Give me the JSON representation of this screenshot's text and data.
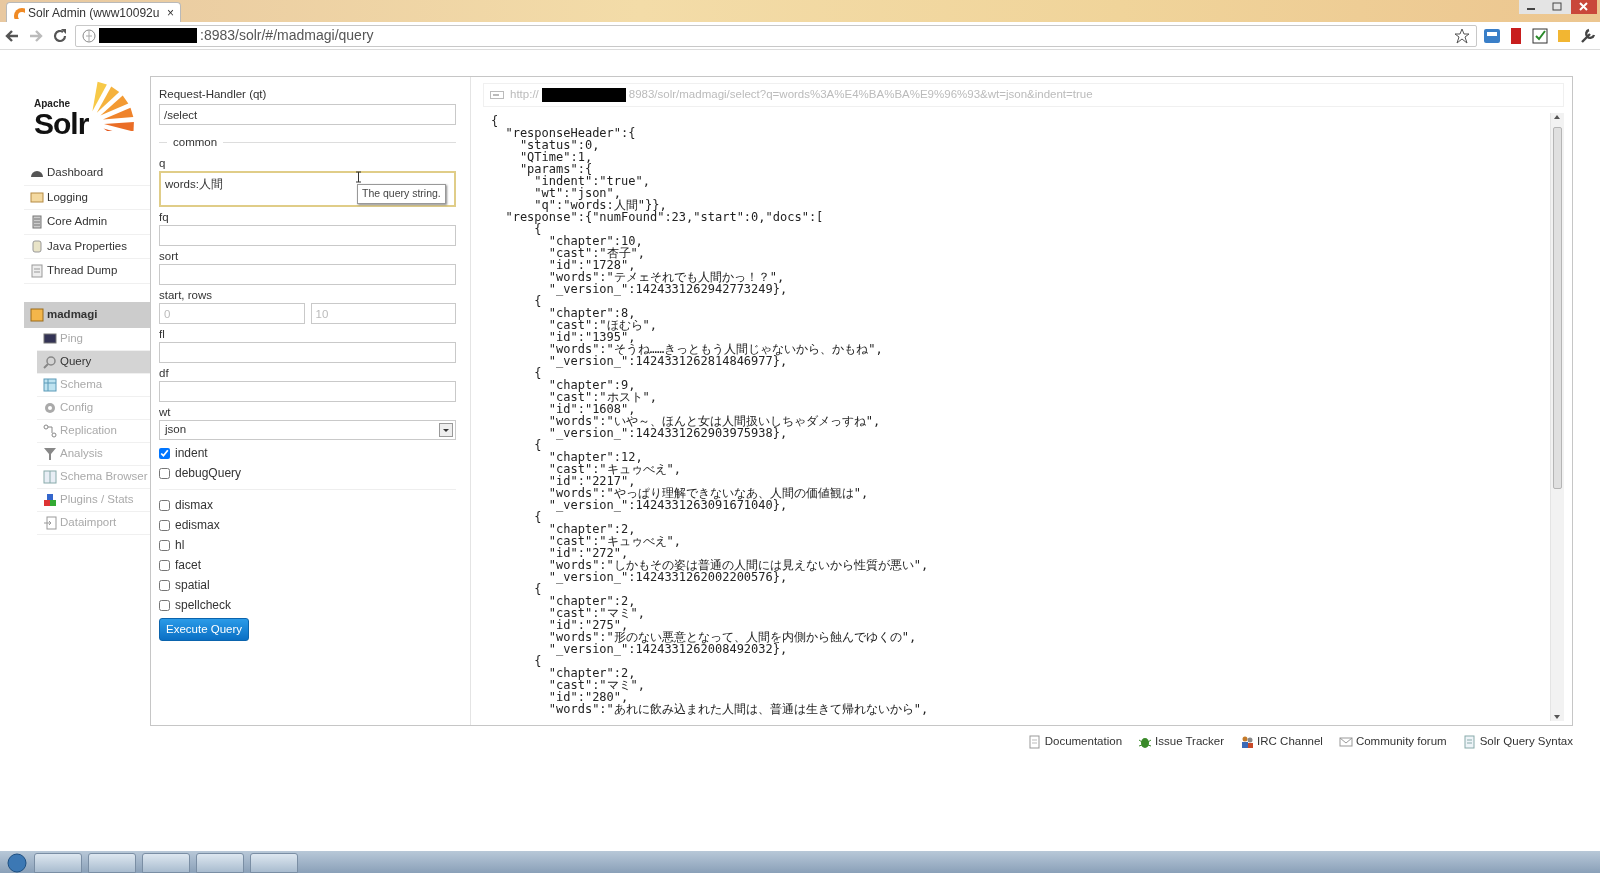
{
  "browser": {
    "tabs": [
      {
        "title": "Solr Admin (www10092u",
        "close": "×",
        "selected": true
      }
    ],
    "address": {
      "suffix": ":8983/solr/#/madmagi/query"
    }
  },
  "logo": {
    "small": "Apache",
    "big": "Solr"
  },
  "main_menu": [
    {
      "label": "Dashboard"
    },
    {
      "label": "Logging"
    },
    {
      "label": "Core Admin"
    },
    {
      "label": "Java Properties"
    },
    {
      "label": "Thread Dump"
    }
  ],
  "core": {
    "label": "madmagi",
    "selected": true
  },
  "core_menu": [
    {
      "label": "Ping",
      "selected": false
    },
    {
      "label": "Query",
      "selected": true
    },
    {
      "label": "Schema",
      "selected": false
    },
    {
      "label": "Config",
      "selected": false
    },
    {
      "label": "Replication",
      "selected": false
    },
    {
      "label": "Analysis",
      "selected": false
    },
    {
      "label": "Schema Browser",
      "selected": false
    },
    {
      "label": "Plugins / Stats",
      "selected": false
    },
    {
      "label": "Dataimport",
      "selected": false
    }
  ],
  "form": {
    "handler": {
      "label": "Request-Handler (qt)",
      "value": "/select"
    },
    "legend": "common",
    "fields": [
      {
        "kind": "textarea",
        "label": "q",
        "value": "words:人間",
        "focused": true,
        "tooltip": "The query string."
      },
      {
        "kind": "text",
        "label": "fq"
      },
      {
        "kind": "text",
        "label": "sort"
      },
      {
        "kind": "pair",
        "label": "start, rows",
        "inputs": [
          {
            "placeholder": "0"
          },
          {
            "placeholder": "10"
          }
        ]
      },
      {
        "kind": "text",
        "label": "fl"
      },
      {
        "kind": "text",
        "label": "df"
      },
      {
        "kind": "select",
        "label": "wt",
        "value": "json"
      }
    ],
    "options": [
      {
        "label": "indent",
        "checked": true
      },
      {
        "label": "debugQuery",
        "checked": false
      }
    ],
    "parsers": [
      {
        "label": "dismax",
        "checked": false
      },
      {
        "label": "edismax",
        "checked": false
      },
      {
        "label": "hl",
        "checked": false
      },
      {
        "label": "facet",
        "checked": false
      },
      {
        "label": "spatial",
        "checked": false
      },
      {
        "label": "spellcheck",
        "checked": false
      }
    ],
    "execute": "Execute Query"
  },
  "response": {
    "url_prefix": "http://",
    "url_suffix": "8983/solr/madmagi/select?q=words%3A%E4%BA%BA%E9%96%93&wt=json&indent=true",
    "lines": [
      "{",
      "  \"responseHeader\":{",
      "    \"status\":0,",
      "    \"QTime\":1,",
      "    \"params\":{",
      "      \"indent\":\"true\",",
      "      \"wt\":\"json\",",
      "      \"q\":\"words:人間\"}},",
      "  \"response\":{\"numFound\":23,\"start\":0,\"docs\":[",
      "      {",
      "        \"chapter\":10,",
      "        \"cast\":\"杏子\",",
      "        \"id\":\"1728\",",
      "        \"words\":\"テメェそれでも人間かっ！？\",",
      "        \"_version_\":1424331262942773249},",
      "      {",
      "        \"chapter\":8,",
      "        \"cast\":\"ほむら\",",
      "        \"id\":\"1395\",",
      "        \"words\":\"そうね……きっともう人間じゃないから、かもね\",",
      "        \"_version_\":1424331262814846977},",
      "      {",
      "        \"chapter\":9,",
      "        \"cast\":\"ホスト\",",
      "        \"id\":\"1608\",",
      "        \"words\":\"いや～、ほんと女は人間扱いしちゃダメっすね\",",
      "        \"_version_\":1424331262903975938},",
      "      {",
      "        \"chapter\":12,",
      "        \"cast\":\"キュゥべえ\",",
      "        \"id\":\"2217\",",
      "        \"words\":\"やっぱり理解できないなあ、人間の価値観は\",",
      "        \"_version_\":1424331263091671040},",
      "      {",
      "        \"chapter\":2,",
      "        \"cast\":\"キュゥべえ\",",
      "        \"id\":\"272\",",
      "        \"words\":\"しかもその姿は普通の人間には見えないから性質が悪い\",",
      "        \"_version_\":1424331262002200576},",
      "      {",
      "        \"chapter\":2,",
      "        \"cast\":\"マミ\",",
      "        \"id\":\"275\",",
      "        \"words\":\"形のない悪意となって、人間を内側から蝕んでゆくの\",",
      "        \"_version_\":1424331262008492032},",
      "      {",
      "        \"chapter\":2,",
      "        \"cast\":\"マミ\",",
      "        \"id\":\"280\",",
      "        \"words\":\"あれに飲み込まれた人間は、普通は生きて帰れないから\","
    ]
  },
  "footer": [
    {
      "label": "Documentation"
    },
    {
      "label": "Issue Tracker"
    },
    {
      "label": "IRC Channel"
    },
    {
      "label": "Community forum"
    },
    {
      "label": "Solr Query Syntax"
    }
  ]
}
